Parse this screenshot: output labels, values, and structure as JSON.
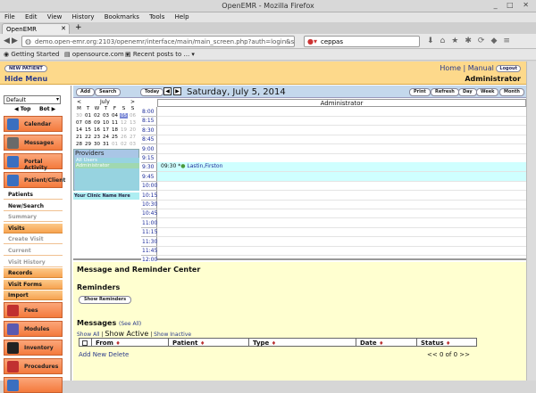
{
  "window": {
    "title": "OpenEMR - Mozilla Firefox",
    "controls": "_ □ ✕"
  },
  "menu": [
    "File",
    "Edit",
    "View",
    "History",
    "Bookmarks",
    "Tools",
    "Help"
  ],
  "tab": {
    "label": "OpenEMR",
    "close": "✕",
    "new": "+"
  },
  "nav": {
    "url": "demo.open-emr.org:2103/openemr/interface/main/main_screen.php?auth=login&site=de",
    "search": "ceppas",
    "back": "◀",
    "forward": "▶"
  },
  "bookmarks": [
    "Getting Started",
    "opensource.com ▾",
    "Recent posts to ... ▾"
  ],
  "app": {
    "new_patient": "NEW PATIENT",
    "hide_menu": "Hide Menu",
    "home": "Home",
    "sep": "|",
    "manual": "Manual",
    "logout": "Logout",
    "user": "Administrator"
  },
  "sidebar": {
    "facility": "Default",
    "top": "Top",
    "bot": "Bot",
    "big": [
      {
        "label": "Calendar",
        "icon": "calendar-icon",
        "color": "#3a6fc0"
      },
      {
        "label": "Messages",
        "icon": "messages-icon",
        "color": "#6a6a6a"
      },
      {
        "label": "Portal Activity",
        "icon": "portal-icon",
        "color": "#3a6fc0"
      },
      {
        "label": "Patient/Client",
        "icon": "patient-icon",
        "color": "#3a6fc0"
      }
    ],
    "small": [
      {
        "label": "Patients",
        "kind": "sub sel"
      },
      {
        "label": "New/Search",
        "kind": "sub sel"
      },
      {
        "label": "Summary",
        "kind": "sub dim"
      },
      {
        "label": "Visits",
        "kind": "hdr"
      },
      {
        "label": "Create Visit",
        "kind": "sub dim"
      },
      {
        "label": "Current",
        "kind": "sub dim"
      },
      {
        "label": "Visit History",
        "kind": "sub dim"
      },
      {
        "label": "Records",
        "kind": "hdr"
      },
      {
        "label": "Visit Forms",
        "kind": "hdr"
      },
      {
        "label": "Import",
        "kind": "hdr"
      }
    ],
    "big2": [
      {
        "label": "Fees",
        "icon": "fees-icon",
        "color": "#c03030"
      },
      {
        "label": "Modules",
        "icon": "modules-icon",
        "color": "#5a5ab0"
      },
      {
        "label": "Inventory",
        "icon": "inventory-icon",
        "color": "#222222"
      },
      {
        "label": "Procedures",
        "icon": "procedures-icon",
        "color": "#c03030"
      },
      {
        "label": "",
        "icon": "admin-icon",
        "color": "#3a6fc0"
      }
    ]
  },
  "calendar": {
    "add": "Add",
    "search": "Search",
    "today": "Today",
    "prev": "◀",
    "next": "▶",
    "date_title": "Saturday, July 5, 2014",
    "print": "Print",
    "refresh": "Refresh",
    "day": "Day",
    "week": "Week",
    "month": "Month",
    "mini": {
      "prev": "<",
      "month": "July",
      "next": ">",
      "dow": [
        "M",
        "T",
        "W",
        "T",
        "F",
        "S",
        "S"
      ],
      "weeks": [
        [
          "30",
          "01",
          "02",
          "03",
          "04",
          "05",
          "06"
        ],
        [
          "07",
          "08",
          "09",
          "10",
          "11",
          "12",
          "13"
        ],
        [
          "14",
          "15",
          "16",
          "17",
          "18",
          "19",
          "20"
        ],
        [
          "21",
          "22",
          "23",
          "24",
          "25",
          "26",
          "27"
        ],
        [
          "28",
          "29",
          "30",
          "31",
          "01",
          "02",
          "03"
        ]
      ],
      "today_index": [
        0,
        5
      ]
    },
    "providers_label": "Providers",
    "providers": [
      "All Users",
      "Administrator"
    ],
    "clinic": "Your Clinic Name Here",
    "column": "Administrator",
    "times": [
      "8:00",
      "8:15",
      "8:30",
      "8:45",
      "9:00",
      "9:15",
      "9:30",
      "9:45",
      "10:00",
      "10:15",
      "10:30",
      "10:45",
      "11:00",
      "11:15",
      "11:30",
      "11:45",
      "12:00"
    ],
    "appointment": {
      "time": "09:30",
      "marker": "*",
      "patient": "Lastin,Firston",
      "slot": 6
    }
  },
  "messages": {
    "center_title": "Message and Reminder Center",
    "reminders_title": "Reminders",
    "show_reminders": "Show Reminders",
    "messages_title": "Messages",
    "see_all": "(See All)",
    "show_all": "Show All",
    "show_active": "Show Active",
    "show_inactive": "Show Inactive",
    "pipe": "|",
    "columns": [
      "From",
      "Patient",
      "Type",
      "Date",
      "Status"
    ],
    "sort_arrow": "♦",
    "add_new": "Add New",
    "delete": "Delete",
    "pager": "<<  0 of 0  >>"
  }
}
